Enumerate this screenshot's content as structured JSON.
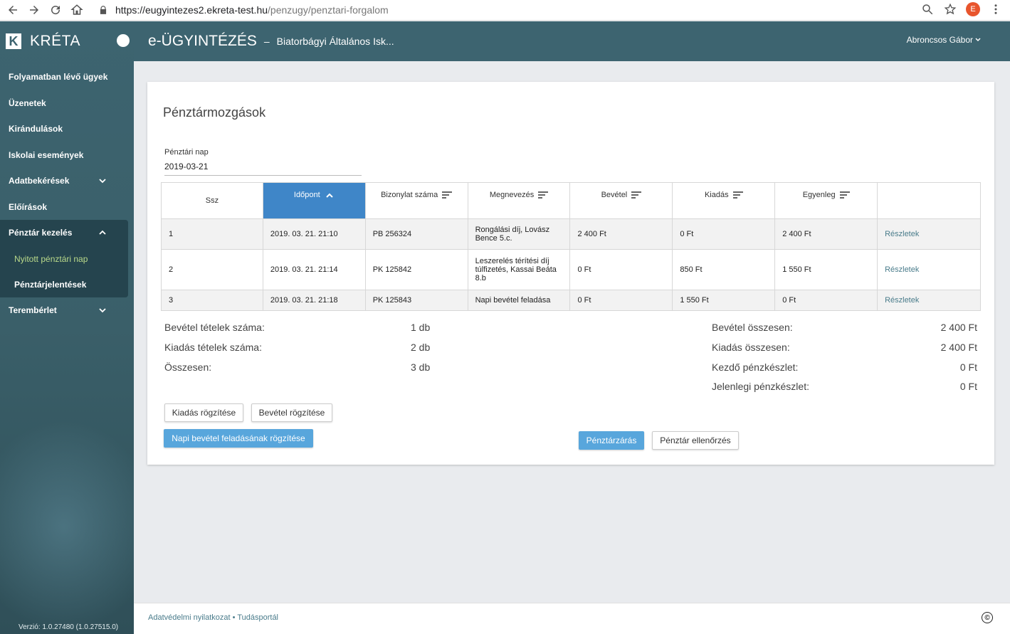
{
  "browser": {
    "url_host": "https://eugyintezes2.ekreta-test.hu",
    "url_path": "/penzugy/penztari-forgalom",
    "profile_initial": "E"
  },
  "sidebar": {
    "brand": "KRÉTA",
    "brand_logo": "K",
    "items": [
      {
        "label": "Folyamatban lévő ügyek"
      },
      {
        "label": "Üzenetek"
      },
      {
        "label": "Kirándulások"
      },
      {
        "label": "Iskolai események"
      },
      {
        "label": "Adatbekérések"
      },
      {
        "label": "Előírások"
      },
      {
        "label": "Pénztár kezelés"
      },
      {
        "label": "Terembérlet"
      }
    ],
    "sub_items": [
      {
        "label": "Nyitott pénztári nap"
      },
      {
        "label": "Pénztárjelentések"
      }
    ],
    "version": "Verzió: 1.0.27480 (1.0.27515.0)"
  },
  "header": {
    "app_title": "e-ÜGYINTÉZÉS",
    "separator": "–",
    "school": "Biatorbágyi Általános Isk...",
    "user": "Abroncsos Gábor"
  },
  "page": {
    "title": "Pénztármozgások",
    "date_label": "Pénztári nap",
    "date_value": "2019-03-21"
  },
  "table": {
    "headers": [
      "Ssz",
      "Időpont",
      "Bizonylat száma",
      "Megnevezés",
      "Bevétel",
      "Kiadás",
      "Egyenleg"
    ],
    "rows": [
      {
        "ssz": "1",
        "time": "2019. 03. 21. 21:10",
        "doc": "PB 256324",
        "name": "Rongálási díj, Lovász Bence 5.c.",
        "income": "2 400 Ft",
        "expense": "0 Ft",
        "balance": "2 400 Ft",
        "link": "Részletek"
      },
      {
        "ssz": "2",
        "time": "2019. 03. 21. 21:14",
        "doc": "PK 125842",
        "name": "Leszerelés térítési díj túlfizetés, Kassai Beáta 8.b",
        "income": "0 Ft",
        "expense": "850 Ft",
        "balance": "1 550 Ft",
        "link": "Részletek"
      },
      {
        "ssz": "3",
        "time": "2019. 03. 21. 21:18",
        "doc": "PK 125843",
        "name": "Napi bevétel feladása",
        "income": "0 Ft",
        "expense": "1 550 Ft",
        "balance": "0 Ft",
        "link": "Részletek"
      }
    ]
  },
  "summary": {
    "left": [
      {
        "label": "Bevétel tételek száma:",
        "value": "1 db"
      },
      {
        "label": "Kiadás tételek száma:",
        "value": "2 db"
      },
      {
        "label": "Összesen:",
        "value": "3 db"
      }
    ],
    "right": [
      {
        "label": "Bevétel összesen:",
        "value": "2 400 Ft"
      },
      {
        "label": "Kiadás összesen:",
        "value": "2 400 Ft"
      },
      {
        "label": "Kezdő pénzkészlet:",
        "value": "0 Ft"
      },
      {
        "label": "Jelenlegi pénzkészlet:",
        "value": "0 Ft"
      }
    ]
  },
  "buttons": {
    "expense": "Kiadás rögzítése",
    "income": "Bevétel rögzítése",
    "daily": "Napi bevétel feladásának rögzítése",
    "close": "Pénztárzárás",
    "check": "Pénztár ellenőrzés"
  },
  "footer": {
    "links": "Adatvédelmi nyilatkozat • Tudásportál",
    "copyright": "©"
  },
  "colors": {
    "primary": "#3d6470",
    "sorted_header": "#3f86c8",
    "button_blue": "#58a6dc",
    "active_sub": "#b9d98a"
  }
}
